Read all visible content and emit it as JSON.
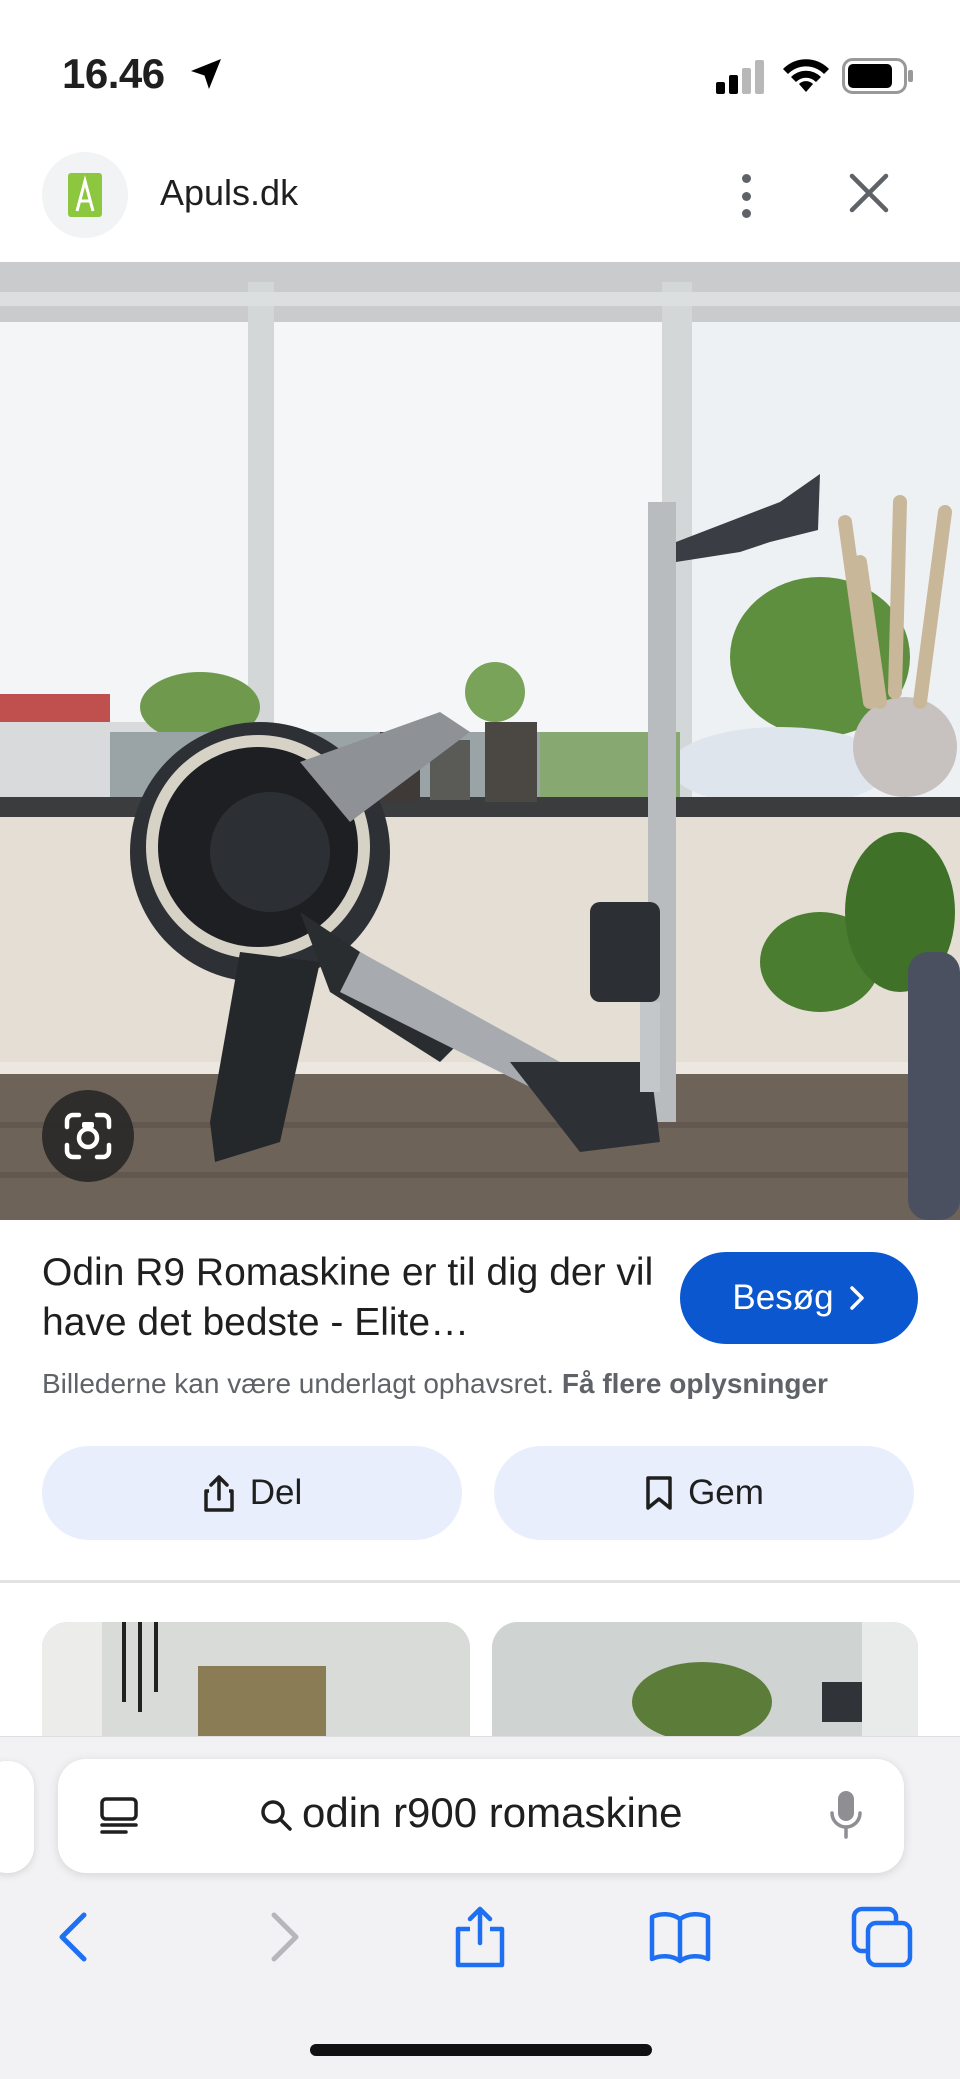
{
  "status_bar": {
    "time": "16.46",
    "icons": [
      "location-arrow-icon",
      "cellular-signal-icon",
      "wifi-icon",
      "battery-icon"
    ]
  },
  "header": {
    "site_name": "Apuls.dk",
    "favicon_letter": "A",
    "favicon_color": "#8dc63f"
  },
  "result": {
    "title": "Odin R9 Romaskine er til dig der vil have det bedste - Elite…",
    "visit_label": "Besøg",
    "copyright_text": "Billederne kan være underlagt ophavsret.",
    "copyright_link": "Få flere oplysninger",
    "share_label": "Del",
    "save_label": "Gem"
  },
  "safari": {
    "address_text": "odin r900 romaskine"
  },
  "colors": {
    "accent": "#0b57d0",
    "pill_bg": "#e8eefb",
    "secondary_text": "#5f6368"
  }
}
